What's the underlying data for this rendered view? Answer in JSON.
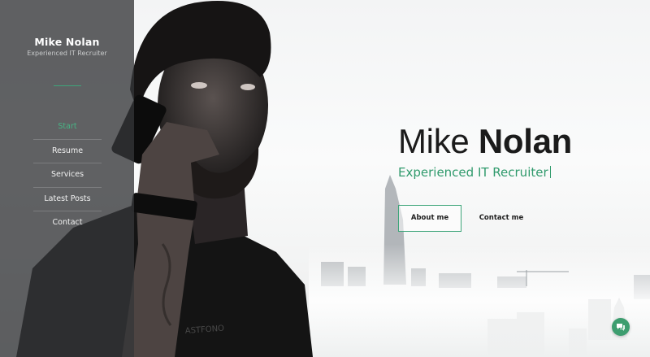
{
  "sidebar": {
    "name": "Mike Nolan",
    "subtitle": "Experienced IT Recruiter",
    "nav": [
      {
        "label": "Start",
        "active": true
      },
      {
        "label": "Resume",
        "active": false
      },
      {
        "label": "Services",
        "active": false
      },
      {
        "label": "Latest Posts",
        "active": false
      },
      {
        "label": "Contact",
        "active": false
      }
    ]
  },
  "hero": {
    "first_name": "Mike",
    "last_name": "Nolan",
    "role": "Experienced IT Recruiter",
    "about_button": "About me",
    "contact_button": "Contact me"
  },
  "colors": {
    "accent": "#3ea57a",
    "sidebar_bg": "#343638",
    "text_dark": "#1b1b1b"
  },
  "icons": {
    "chat": "chat-bubbles-icon"
  }
}
